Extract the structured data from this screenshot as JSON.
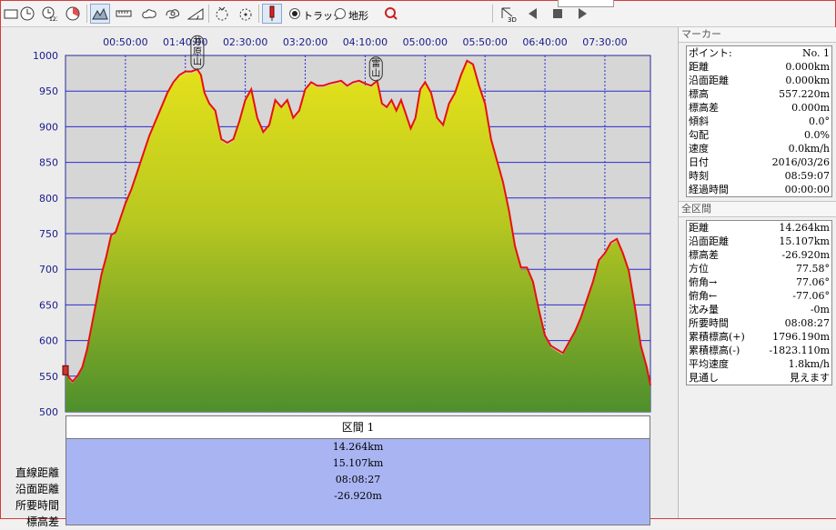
{
  "toolbar": {
    "buttons": [
      {
        "name": "window-icon"
      },
      {
        "name": "clock-icon"
      },
      {
        "name": "clock-123-icon"
      },
      {
        "name": "dial-icon"
      },
      {
        "name": "mountain-profile-icon"
      },
      {
        "name": "ruler-icon"
      },
      {
        "name": "cloud-shape-icon"
      },
      {
        "name": "cloud-swirl-icon"
      },
      {
        "name": "slope-icon"
      },
      {
        "name": "dotted-circle-icon"
      },
      {
        "name": "dotted-circle-2-icon"
      },
      {
        "name": "pin-marker-icon"
      }
    ],
    "radio_track": "トラック",
    "radio_terrain": "地形",
    "view3d_label": "3D"
  },
  "chart_data": {
    "type": "area",
    "title": "",
    "xlabel": "",
    "ylabel": "",
    "ylim": [
      500,
      1000
    ],
    "xlim_minutes": [
      0,
      488
    ],
    "x_ticks": [
      "00:50:00",
      "01:40:00",
      "02:30:00",
      "03:20:00",
      "04:10:00",
      "05:00:00",
      "05:50:00",
      "06:40:00",
      "07:30:00"
    ],
    "x_tick_minutes": [
      50,
      100,
      150,
      200,
      250,
      300,
      350,
      400,
      450
    ],
    "y_ticks": [
      500,
      550,
      600,
      650,
      700,
      750,
      800,
      850,
      900,
      950,
      1000
    ],
    "grid": true,
    "peak_labels": [
      {
        "text": "井原山",
        "minute": 110
      },
      {
        "text": "雷山",
        "minute": 259
      }
    ],
    "series": [
      {
        "values_note_x_minutes": [
          0,
          3,
          6,
          10,
          14,
          18,
          22,
          26,
          30,
          34,
          38,
          42,
          46,
          50,
          55,
          60,
          65,
          70,
          75,
          80,
          85,
          90,
          95,
          100,
          105,
          110,
          113,
          116,
          120,
          125,
          130,
          135,
          140,
          145,
          150,
          155,
          160,
          165,
          170,
          175,
          180,
          185,
          190,
          195,
          200,
          205,
          210,
          215,
          220,
          225,
          230,
          235,
          240,
          245,
          250,
          255,
          260,
          264,
          268,
          272,
          276,
          280,
          284,
          288,
          292,
          296,
          300,
          305,
          310,
          315,
          320,
          325,
          330,
          335,
          340,
          345,
          350,
          355,
          360,
          365,
          370,
          375,
          380,
          385,
          390,
          395,
          400,
          405,
          410,
          415,
          420,
          425,
          430,
          435,
          440,
          445,
          450,
          455,
          460,
          465,
          470,
          475,
          480,
          485,
          488
        ],
        "values": [
          557,
          545,
          540,
          548,
          560,
          585,
          620,
          655,
          690,
          715,
          745,
          750,
          770,
          790,
          810,
          835,
          860,
          885,
          905,
          925,
          945,
          960,
          970,
          975,
          975,
          978,
          970,
          945,
          930,
          920,
          880,
          875,
          880,
          905,
          935,
          950,
          910,
          890,
          900,
          935,
          925,
          935,
          910,
          920,
          950,
          960,
          955,
          955,
          958,
          960,
          962,
          955,
          960,
          962,
          958,
          955,
          962,
          930,
          925,
          935,
          920,
          935,
          915,
          895,
          910,
          950,
          960,
          945,
          910,
          900,
          930,
          945,
          970,
          990,
          985,
          955,
          930,
          880,
          850,
          820,
          780,
          730,
          700,
          700,
          680,
          640,
          605,
          590,
          585,
          580,
          595,
          610,
          630,
          655,
          680,
          710,
          720,
          735,
          740,
          720,
          695,
          645,
          590,
          560,
          535
        ]
      }
    ]
  },
  "section": {
    "header": "区間 1",
    "labels": [
      "直線距離",
      "沿面距離",
      "所要時間",
      "標高差"
    ],
    "values": [
      "14.264km",
      "15.107km",
      "08:08:27",
      "-26.920m"
    ]
  },
  "marker_panel": {
    "title": "マーカー",
    "rows": [
      {
        "k": "ポイント:",
        "v": "No. 1"
      },
      {
        "k": "距離",
        "v": "0.000km"
      },
      {
        "k": "沿面距離",
        "v": "0.000km"
      },
      {
        "k": "標高",
        "v": "557.220m"
      },
      {
        "k": "標高差",
        "v": "0.000m"
      },
      {
        "k": "傾斜",
        "v": "0.0°"
      },
      {
        "k": "勾配",
        "v": "0.0%"
      },
      {
        "k": "速度",
        "v": "0.0km/h"
      },
      {
        "k": "日付",
        "v": "2016/03/26"
      },
      {
        "k": "時刻",
        "v": "08:59:07"
      },
      {
        "k": "経過時間",
        "v": "00:00:00"
      }
    ]
  },
  "all_section_panel": {
    "title": "全区間",
    "rows": [
      {
        "k": "距離",
        "v": "14.264km"
      },
      {
        "k": "沿面距離",
        "v": "15.107km"
      },
      {
        "k": "標高差",
        "v": "-26.920m"
      },
      {
        "k": "方位",
        "v": "77.58°"
      },
      {
        "k": "俯角→",
        "v": "77.06°"
      },
      {
        "k": "俯角←",
        "v": "-77.06°"
      },
      {
        "k": "沈み量",
        "v": "-0m"
      },
      {
        "k": "所要時間",
        "v": "08:08:27"
      },
      {
        "k": "累積標高(+)",
        "v": "1796.190m"
      },
      {
        "k": "累積標高(-)",
        "v": "-1823.110m"
      },
      {
        "k": "平均速度",
        "v": "1.8km/h"
      },
      {
        "k": "見通し",
        "v": "見えます"
      }
    ]
  }
}
